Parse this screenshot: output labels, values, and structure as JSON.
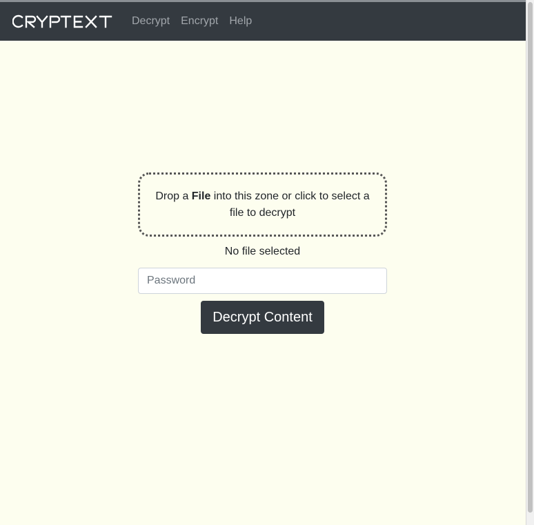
{
  "navbar": {
    "brand": "CRYPTEXT",
    "links": [
      {
        "label": "Decrypt"
      },
      {
        "label": "Encrypt"
      },
      {
        "label": "Help"
      }
    ]
  },
  "dropzone": {
    "text_before": "Drop a ",
    "text_bold": "File",
    "text_after": " into this zone or click to select a file to decrypt"
  },
  "file_status": "No file selected",
  "password": {
    "value": "",
    "placeholder": "Password"
  },
  "decrypt_button": "Decrypt Content",
  "colors": {
    "navbar_bg": "#343a40",
    "page_bg": "#fdfeef",
    "nav_link": "#a1a6ab",
    "button_bg": "#343a40"
  }
}
